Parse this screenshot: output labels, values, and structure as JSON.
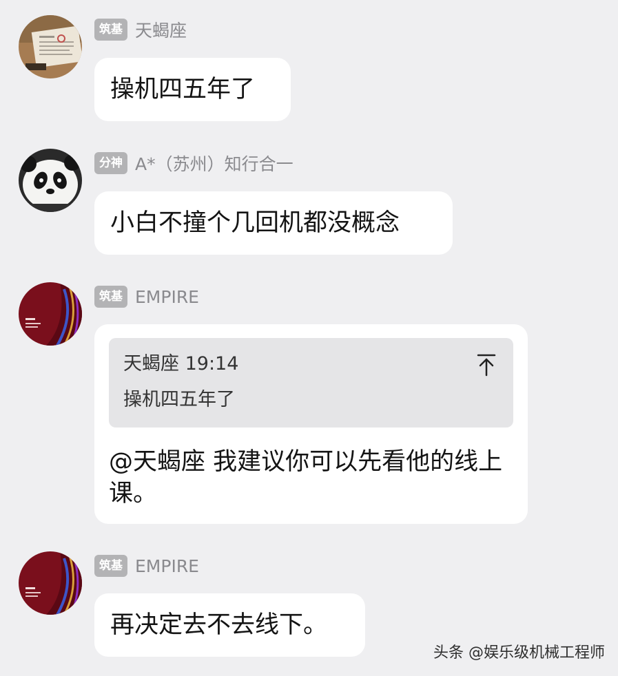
{
  "messages": [
    {
      "rank": "筑基",
      "user": "天蝎座",
      "avatar_icon": "newspaper-photo-avatar",
      "text": "操机四五年了"
    },
    {
      "rank": "分神",
      "user": "A*（苏州）知行合一",
      "avatar_icon": "panda-photo-avatar",
      "text": "小白不撞个几回机都没概念"
    },
    {
      "rank": "筑基",
      "user": "EMPIRE",
      "avatar_icon": "dark-red-abstract-avatar",
      "quote": {
        "author_time": "天蝎座 19:14",
        "text": "操机四五年了",
        "jump_icon": "arrow-up-to-top-icon"
      },
      "text": "@天蝎座 我建议你可以先看他的线上课。"
    },
    {
      "rank": "筑基",
      "user": "EMPIRE",
      "avatar_icon": "dark-red-abstract-avatar",
      "text": "再决定去不去线下。"
    }
  ],
  "watermark": "头条 @娱乐级机械工程师",
  "colors": {
    "background": "#efeff1",
    "bubble": "#ffffff",
    "quote_background": "#e5e5e7",
    "rank_badge": "#b3b3b5",
    "username": "#8a8a8e"
  }
}
